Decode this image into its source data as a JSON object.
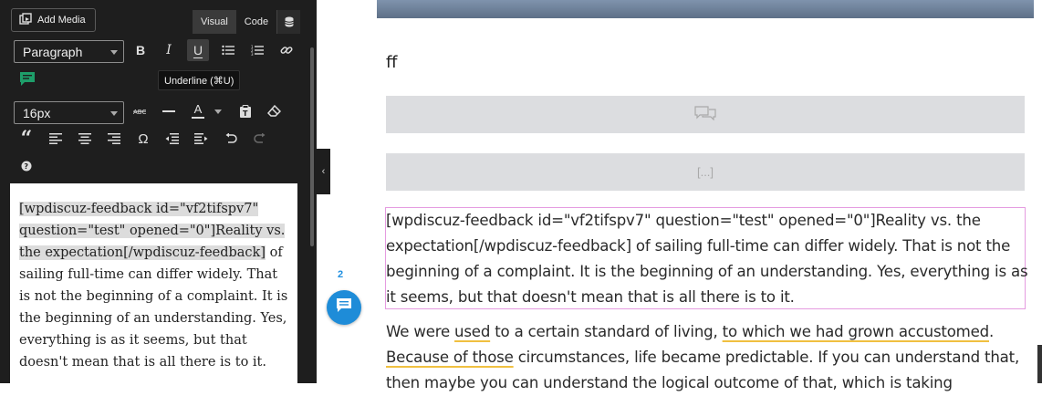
{
  "toolbar": {
    "add_media": "Add Media",
    "tab_visual": "Visual",
    "tab_code": "Code",
    "format_select": "Paragraph",
    "font_size_select": "16px",
    "tooltip": "Underline (⌘U)",
    "text_color_label": "A"
  },
  "editor": {
    "shortcode": "[wpdiscuz-feedback id=\"vf2tifspv7\" question=\"test\" opened=\"0\"]Reality vs. the expectation[/wpdiscuz-feedback]",
    "rest": " of sailing full-time can differ widely. That is not the beginning of a complaint. It is the beginning of an understanding. Yes, everything is as it seems, but that doesn't mean that is all there is to it."
  },
  "preview": {
    "ff": "ff",
    "bar2_text": "[...]",
    "comment_count": "2",
    "para1": "[wpdiscuz-feedback id=\"vf2tifspv7\" question=\"test\" opened=\"0\"]Reality vs. the expectation[/wpdiscuz-feedback] of sailing full-time can differ widely. That is not the beginning of a complaint. It is the beginning of an understanding. Yes, everything is as it seems, but that doesn't mean that is all there is to it.",
    "p2_a": "We were ",
    "p2_b": "used",
    "p2_c": " to a certain standard of living, ",
    "p2_d": "to which we had grown accustomed",
    "p2_e": ". ",
    "p2_f": "Because of those",
    "p2_g": " circumstances, life became predictable. If you can understand that, then maybe you can understand the logical outcome of that, which is taking"
  },
  "colors": {
    "panel_bg": "#1e1e1e",
    "accent_blue": "#1e8cd8",
    "comment_green": "#1e9e6a",
    "feedback_border": "#e59be0",
    "spell_underline": "#f0c040"
  }
}
